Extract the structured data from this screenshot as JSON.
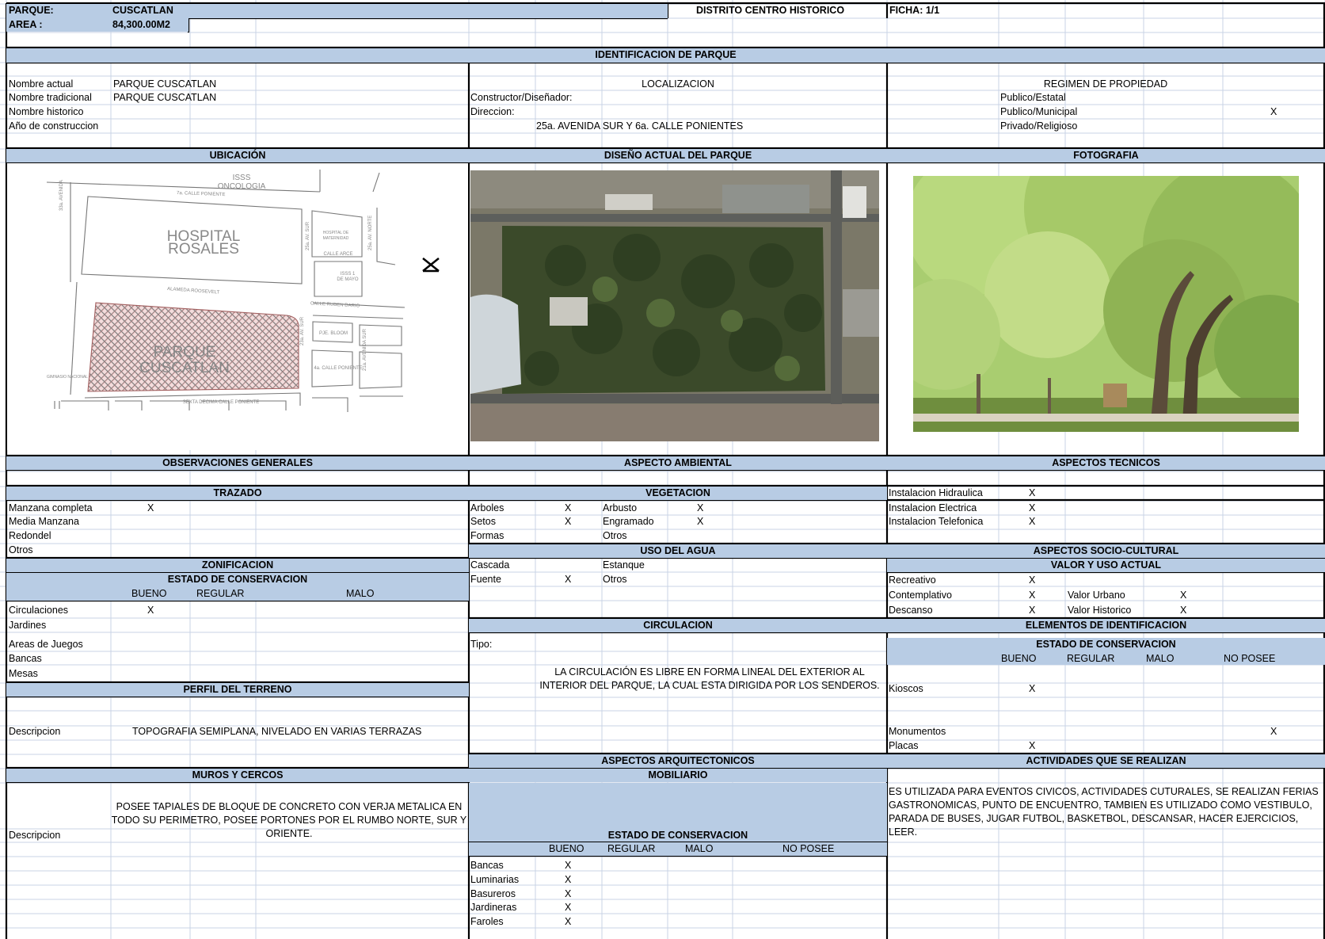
{
  "header": {
    "parque_label": "PARQUE:",
    "parque_value": "CUSCATLAN",
    "distrito": "DISTRITO CENTRO HISTORICO",
    "ficha": "FICHA: 1/1",
    "area_label": "AREA :",
    "area_value": "84,300.00M2"
  },
  "identificacion": {
    "title": "IDENTIFICACION DE  PARQUE",
    "labels": [
      "Nombre actual",
      "Nombre tradicional",
      "Nombre historico",
      "Año de construccion"
    ],
    "values": [
      "PARQUE CUSCATLAN",
      "PARQUE CUSCATLAN"
    ],
    "localizacion": "LOCALIZACION",
    "constructor": "Constructor/Diseñador:",
    "direccion": "Direccion:",
    "direccion_value": "25a. AVENIDA SUR Y 6a. CALLE PONIENTES",
    "regimen": "REGIMEN DE PROPIEDAD",
    "regimen_opts": [
      "Publico/Estatal",
      "Publico/Municipal",
      "Privado/Religioso"
    ],
    "regimen_mark": "X"
  },
  "sections": {
    "ubicacion": "UBICACIÓN",
    "diseno": "DISEÑO ACTUAL DEL PARQUE",
    "fotografia": "FOTOGRAFIA",
    "observaciones": "OBSERVACIONES GENERALES",
    "ambiental": "ASPECTO AMBIENTAL",
    "tecnicos": "ASPECTOS TECNICOS"
  },
  "map": {
    "isss": "ISSS",
    "oncologia": "ONCOLOGIA",
    "calle7": "7a. CALLE PONIENTE",
    "hospital1": "HOSPITAL",
    "hospital2": "ROSALES",
    "maternidad1": "HOSPITAL DE",
    "maternidad2": "MATERNIDAD",
    "calle_arce": "CALLE ARCE",
    "isss1": "ISSS 1",
    "mayo": "DE MAYO",
    "alameda": "ALAMEDA ROOSEVELT",
    "ruben": "CALLE RUBEN DARIO",
    "parque1": "PARQUE",
    "parque2": "CUSCATLAN",
    "bloom": "PJE. BLOOM",
    "calle4": "4a. CALLE PONIENTE",
    "gimnasio": "GIMNASIO NACIONAL",
    "sexta": "SEXTA DECIMA CALLE PONIENTE",
    "av33": "33a. AVENIDA",
    "av25": "25a. AV. SUR",
    "av25n": "25a. AV. NORTE",
    "av23": "23a. AV. SUR",
    "av21": "21a. AVENIDA SUR",
    "sur": "SUR"
  },
  "trazado": {
    "title": "TRAZADO",
    "items": [
      "Manzana completa",
      "Media Manzana",
      "Redondel",
      "Otros"
    ],
    "mark": "X"
  },
  "zonificacion": {
    "title": "ZONIFICACION",
    "estado": "ESTADO DE CONSERVACION",
    "cols": [
      "BUENO",
      "REGULAR",
      "MALO"
    ],
    "items": [
      "Circulaciones",
      "Jardines",
      "Areas de Juegos",
      "Bancas",
      "Mesas"
    ],
    "mark": "X"
  },
  "perfil": {
    "title": "PERFIL DEL TERRENO",
    "label": "Descripcion",
    "text": "TOPOGRAFIA SEMIPLANA, NIVELADO EN VARIAS TERRAZAS"
  },
  "muros": {
    "title": "MUROS Y CERCOS",
    "label": "Descripcion",
    "text": "POSEE TAPIALES DE BLOQUE DE CONCRETO CON VERJA METALICA EN TODO SU PERIMETRO, POSEE PORTONES POR EL RUMBO NORTE, SUR Y ORIENTE."
  },
  "vegetacion": {
    "title": "VEGETACION",
    "left": [
      "Arboles",
      "Setos",
      "Formas"
    ],
    "right": [
      "Arbusto",
      "Engramado",
      "Otros"
    ],
    "mark": "X"
  },
  "agua": {
    "title": "USO DEL AGUA",
    "left": [
      "Cascada",
      "Fuente"
    ],
    "right": [
      "Estanque",
      "Otros"
    ],
    "mark": "X"
  },
  "circulacion": {
    "title": "CIRCULACION",
    "label": "Tipo:",
    "text": "LA CIRCULACIÓN ES LIBRE EN FORMA LINEAL DEL EXTERIOR AL INTERIOR DEL PARQUE, LA CUAL ESTA DIRIGIDA POR LOS SENDEROS."
  },
  "arquitectonicos": {
    "title": "ASPECTOS ARQUITECTONICOS",
    "mobiliario": "MOBILIARIO",
    "estado": "ESTADO DE CONSERVACION",
    "cols": [
      "BUENO",
      "REGULAR",
      "MALO",
      "NO POSEE"
    ],
    "items": [
      "Bancas",
      "Luminarias",
      "Basureros",
      "Jardineras",
      "Faroles"
    ],
    "mark": "X"
  },
  "tecnicos": {
    "items": [
      "Instalacion Hidraulica",
      "Instalacion Electrica",
      "Instalacion Telefonica"
    ],
    "mark": "X"
  },
  "socio": {
    "title": "ASPECTOS SOCIO-CULTURAL",
    "valor": "VALOR   Y USO ACTUAL",
    "left": [
      "Recreativo",
      "Contemplativo",
      "Descanso"
    ],
    "right": [
      "Valor Urbano",
      "Valor Historico"
    ],
    "mark": "X"
  },
  "elementos": {
    "title": "ELEMENTOS DE IDENTIFICACION",
    "estado": "ESTADO DE CONSERVACION",
    "cols": [
      "BUENO",
      "REGULAR",
      "MALO",
      "NO POSEE"
    ],
    "items": [
      "Kioscos",
      "Monumentos",
      "Placas"
    ],
    "mark": "X"
  },
  "actividades": {
    "title": "ACTIVIDADES QUE SE REALIZAN",
    "text": "ES UTILIZADA PARA EVENTOS CIVICOS,  ACTIVIDADES CUTURALES, SE REALIZAN FERIAS GASTRONOMICAS,   PUNTO DE ENCUENTRO,  TAMBIEN ES UTILIZADO COMO VESTIBULO, PARADA DE BUSES, JUGAR FUTBOL, BASKETBOL, DESCANSAR, HACER EJERCICIOS, LEER."
  },
  "colors": {
    "header_fill": "#b8cce4",
    "grid": "#c9d3e6",
    "border": "#000000"
  }
}
